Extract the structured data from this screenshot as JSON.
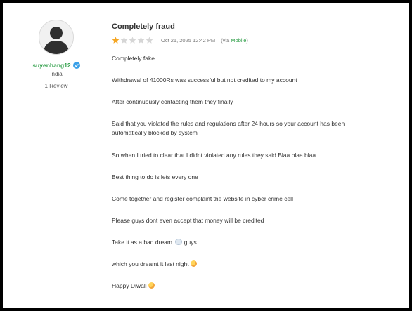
{
  "author": {
    "username": "suyenhang12",
    "country": "India",
    "review_count": "1 Review",
    "verified_icon": "verified-badge-icon",
    "avatar_icon": "user-silhouette-icon"
  },
  "review": {
    "title": "Completely fraud",
    "rating": 1,
    "rating_max": 5,
    "date": "Oct 21, 2025 12:42 PM",
    "via_prefix": "(via ",
    "via_source": "Mobile",
    "via_suffix": ")",
    "paragraphs": [
      "Completely fake",
      "Withdrawal of 41000Rs was successful but not credited to my account",
      "After continuously contacting them they finally",
      "Said that you violated the rules and regulations after 24 hours so your account has been automatically blocked by system",
      "So when I tried to clear that I didnt violated any rules they said Blaa blaa blaa",
      "Best thing to do is lets every one",
      "Come together and register complaint the website in cyber crime cell",
      "Please guys dont even accept that money will be credited",
      "Take it as a bad dream",
      "which you dreamt it last night",
      "Happy Diwali"
    ],
    "para_9_suffix": "guys"
  },
  "colors": {
    "accent_green": "#2e9e48",
    "star_filled": "#f5a623",
    "star_empty": "#d6d6d6",
    "verified_blue": "#3aa0e8"
  }
}
